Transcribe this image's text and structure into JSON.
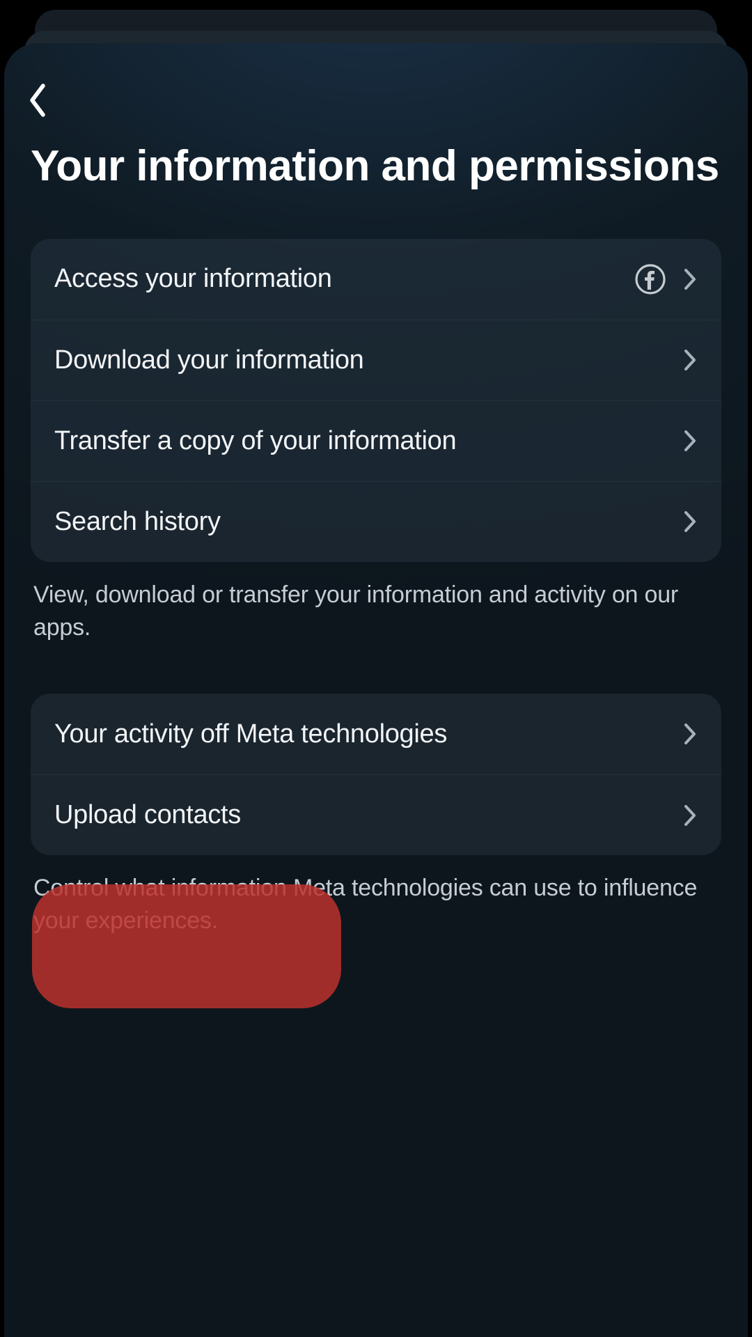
{
  "header": {
    "title": "Your information and permissions"
  },
  "groups": [
    {
      "items": [
        {
          "label": "Access your information",
          "has_fb_icon": true
        },
        {
          "label": "Download your information",
          "has_fb_icon": false
        },
        {
          "label": "Transfer a copy of your information",
          "has_fb_icon": false
        },
        {
          "label": "Search history",
          "has_fb_icon": false
        }
      ],
      "description": "View, download or transfer your information and activity on our apps."
    },
    {
      "items": [
        {
          "label": "Your activity off Meta technologies",
          "has_fb_icon": false
        },
        {
          "label": "Upload contacts",
          "has_fb_icon": false,
          "highlighted": true
        }
      ],
      "description": "Control what information Meta technologies can use to influence your experiences."
    }
  ]
}
